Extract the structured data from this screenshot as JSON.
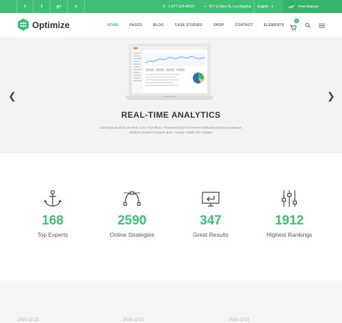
{
  "topbar": {
    "social": [
      {
        "icon": "twitter-icon",
        "glyph": "t"
      },
      {
        "icon": "facebook-icon",
        "glyph": "f"
      },
      {
        "icon": "google-plus-icon",
        "glyph": "g+"
      },
      {
        "icon": "vine-icon",
        "glyph": "v"
      }
    ],
    "phone": "1-677-124-44227",
    "address": "457 S Olive St, Los Angeles",
    "language": "English",
    "cta_label": "Free Analysis"
  },
  "header": {
    "logo_text": "Optimize",
    "nav": [
      "HOME",
      "PAGES",
      "BLOG",
      "CASE STUDIES",
      "SHOP",
      "CONTACT",
      "ELEMENTS"
    ],
    "active_nav": "HOME",
    "cart_count": "0"
  },
  "hero": {
    "title": "REAL-TIME ANALYTICS",
    "text": "Lorem ipsum dolor sit amet, nunc risus libero. Praesent lacus non lorem vestibulum rhoncus a tempus. Eleifend sensem et ipsum dolor. Aenean mattis nisl volutpat."
  },
  "stats": [
    {
      "icon": "anchor-icon",
      "value": "168",
      "label": "Top Experts"
    },
    {
      "icon": "bezier-curve-icon",
      "value": "2590",
      "label": "Online Strategies"
    },
    {
      "icon": "monitor-return-icon",
      "value": "347",
      "label": "Great Results"
    },
    {
      "icon": "equalizer-sliders-icon",
      "value": "1912",
      "label": "Highest Rankings"
    }
  ],
  "blog": {
    "dates": [
      "2015-12-22",
      "2015-12-22",
      "2015-12-22"
    ]
  },
  "colors": {
    "accent": "#3fbf76",
    "hero_bg": "#f3f3f3"
  }
}
